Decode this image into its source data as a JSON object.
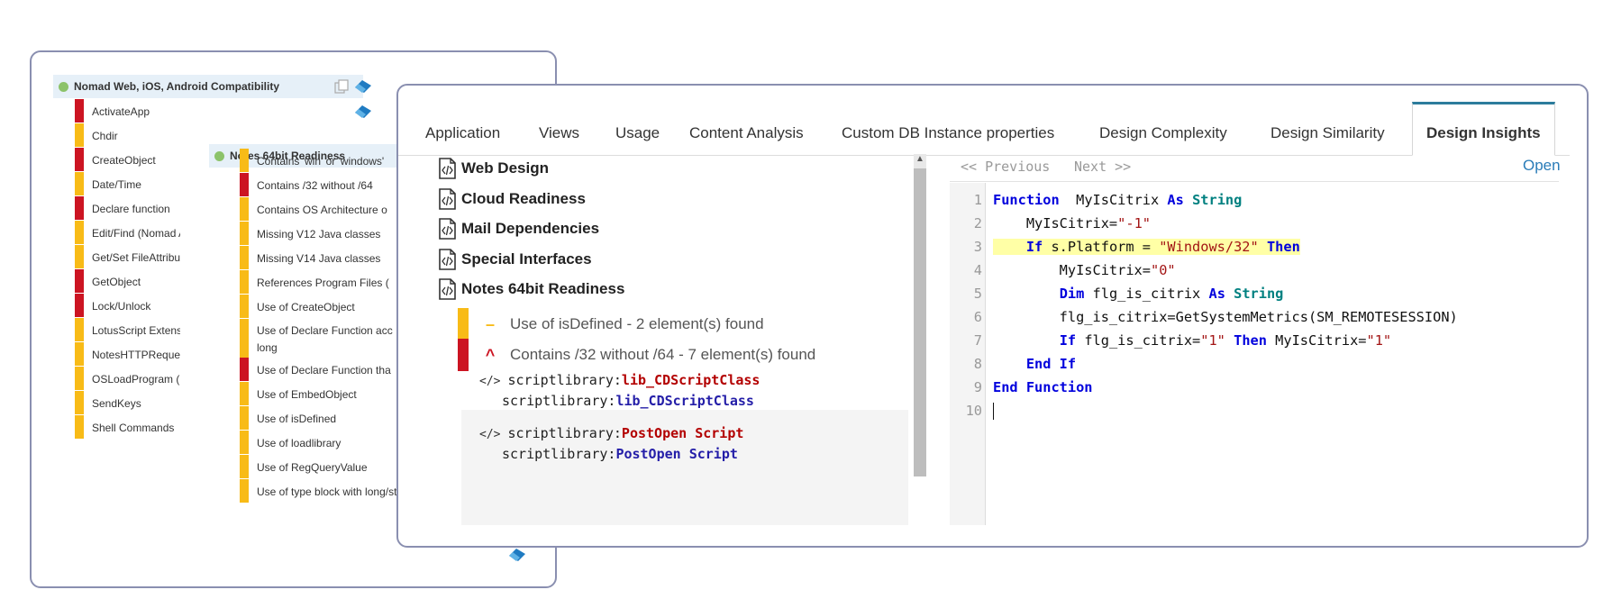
{
  "back_panel": {
    "group_web": {
      "title": "Nomad Web, iOS, Android Compatibility"
    },
    "web_items": [
      {
        "label": "ActivateApp",
        "severity": "high"
      },
      {
        "label": "Chdir",
        "severity": "mid"
      },
      {
        "label": "CreateObject",
        "severity": "high"
      },
      {
        "label": "Date/Time",
        "severity": "mid"
      },
      {
        "label": "Declare function",
        "severity": "high"
      },
      {
        "label": "Edit/Find (Nomad Ar",
        "severity": "mid"
      },
      {
        "label": "Get/Set FileAttribute",
        "severity": "mid"
      },
      {
        "label": "GetObject",
        "severity": "high"
      },
      {
        "label": "Lock/Unlock",
        "severity": "high"
      },
      {
        "label": "LotusScript Extensic",
        "severity": "mid"
      },
      {
        "label": "NotesHTTPRequest",
        "severity": "mid"
      },
      {
        "label": "OSLoadProgram (No",
        "severity": "mid"
      },
      {
        "label": "SendKeys",
        "severity": "mid"
      },
      {
        "label": "Shell Commands",
        "severity": "mid"
      }
    ],
    "group_64": {
      "title": "Notes 64bit Readiness"
    },
    "items_64": [
      {
        "label": "Contains 'win' or 'windows'",
        "severity": "mid"
      },
      {
        "label": "Contains /32 without /64",
        "severity": "high"
      },
      {
        "label": "Contains OS Architecture o",
        "severity": "mid"
      },
      {
        "label": "Missing V12 Java classes",
        "severity": "mid"
      },
      {
        "label": "Missing V14 Java classes",
        "severity": "mid"
      },
      {
        "label": "References Program Files (",
        "severity": "mid"
      },
      {
        "label": "Use of CreateObject",
        "severity": "mid"
      },
      {
        "label": "Use of Declare Function acc long",
        "severity": "mid",
        "wrap": true
      },
      {
        "label": "Use of Declare Function tha",
        "severity": "high"
      },
      {
        "label": "Use of EmbedObject",
        "severity": "mid"
      },
      {
        "label": "Use of isDefined",
        "severity": "mid"
      },
      {
        "label": "Use of loadlibrary",
        "severity": "mid"
      },
      {
        "label": "Use of RegQueryValue",
        "severity": "mid"
      },
      {
        "label": "Use of type block with long/string",
        "severity": "mid"
      }
    ]
  },
  "tabs": [
    {
      "label": "Application"
    },
    {
      "label": "Views"
    },
    {
      "label": "Usage"
    },
    {
      "label": "Content Analysis"
    },
    {
      "label": "Custom DB Instance properties"
    },
    {
      "label": "Design Complexity"
    },
    {
      "label": "Design Similarity"
    },
    {
      "label": "Design Insights",
      "active": true
    }
  ],
  "sections": [
    {
      "label": "Web Design"
    },
    {
      "label": "Cloud Readiness"
    },
    {
      "label": "Mail Dependencies"
    },
    {
      "label": "Special Interfaces"
    },
    {
      "label": "Notes 64bit Readiness"
    }
  ],
  "findings": [
    {
      "label": "Use of isDefined - 2 element(s) found",
      "severity": "mid",
      "icon": "minus-icon",
      "glyph": "–"
    },
    {
      "label": "Contains /32 without /64 - 7 element(s) found",
      "severity": "high",
      "icon": "chevron-up-icon",
      "glyph": "^"
    }
  ],
  "references": [
    {
      "prefix": "scriptlibrary:",
      "name": "lib_CDScriptClass",
      "style": "red",
      "tag": "</>"
    },
    {
      "prefix": "scriptlibrary:",
      "name": "lib_CDScriptClass",
      "style": "blue"
    },
    {
      "prefix": "scriptlibrary:",
      "name": "PostOpen Script",
      "style": "red",
      "tag": "</>"
    },
    {
      "prefix": "scriptlibrary:",
      "name": "PostOpen Script",
      "style": "blue"
    }
  ],
  "editor": {
    "previous": "<< Previous",
    "next": "Next >>",
    "open": "Open",
    "lines": [
      {
        "n": "1",
        "tokens": [
          [
            "kw",
            "Function"
          ],
          [
            "",
            "  MyIsCitrix "
          ],
          [
            "kw",
            "As"
          ],
          [
            "",
            " "
          ],
          [
            "ty",
            "String"
          ]
        ]
      },
      {
        "n": "2",
        "tokens": [
          [
            "",
            "    MyIsCitrix="
          ],
          [
            "st",
            "\"-1\""
          ]
        ]
      },
      {
        "n": "3",
        "highlight": true,
        "tokens": [
          [
            "",
            "    "
          ],
          [
            "kw",
            "If"
          ],
          [
            "",
            " s.Platform = "
          ],
          [
            "st",
            "\"Windows/32\""
          ],
          [
            "",
            " "
          ],
          [
            "kw",
            "Then"
          ]
        ]
      },
      {
        "n": "4",
        "tokens": [
          [
            "",
            "        MyIsCitrix="
          ],
          [
            "st",
            "\"0\""
          ]
        ]
      },
      {
        "n": "5",
        "tokens": [
          [
            "",
            "        "
          ],
          [
            "kw",
            "Dim"
          ],
          [
            "",
            " flg_is_citrix "
          ],
          [
            "kw",
            "As"
          ],
          [
            "",
            " "
          ],
          [
            "ty",
            "String"
          ]
        ]
      },
      {
        "n": "6",
        "tokens": [
          [
            "",
            "        flg_is_citrix=GetSystemMetrics(SM_REMOTESESSION)"
          ]
        ]
      },
      {
        "n": "7",
        "tokens": [
          [
            "",
            "        "
          ],
          [
            "kw",
            "If"
          ],
          [
            "",
            " flg_is_citrix="
          ],
          [
            "st",
            "\"1\""
          ],
          [
            "",
            " "
          ],
          [
            "kw",
            "Then"
          ],
          [
            "",
            " MyIsCitrix="
          ],
          [
            "st",
            "\"1\""
          ]
        ]
      },
      {
        "n": "8",
        "tokens": [
          [
            "",
            "    "
          ],
          [
            "kw",
            "End If"
          ]
        ]
      },
      {
        "n": "9",
        "tokens": [
          [
            "kw",
            "End Function"
          ]
        ]
      },
      {
        "n": "10",
        "tokens": [],
        "cursor": true
      }
    ]
  },
  "colors": {
    "high": "#cc1422",
    "mid": "#f8bb17",
    "accent": "#2c7c9c"
  }
}
